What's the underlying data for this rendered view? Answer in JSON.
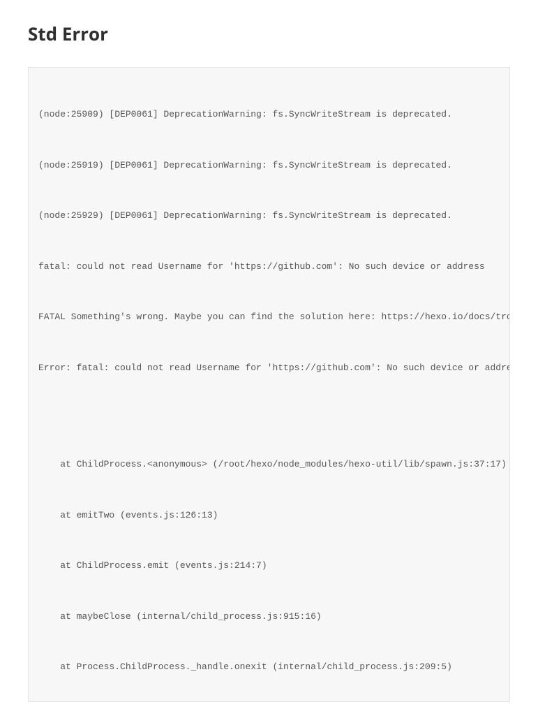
{
  "heading": "Std Error",
  "lines": [
    "(node:25909) [DEP0061] DeprecationWarning: fs.SyncWriteStream is deprecated.",
    "(node:25919) [DEP0061] DeprecationWarning: fs.SyncWriteStream is deprecated.",
    "(node:25929) [DEP0061] DeprecationWarning: fs.SyncWriteStream is deprecated.",
    "fatal: could not read Username for 'https://github.com': No such device or address",
    "FATAL Something's wrong. Maybe you can find the solution here: https://hexo.io/docs/troubleshooting.html",
    "Error: fatal: could not read Username for 'https://github.com': No such device or address",
    "",
    "    at ChildProcess.<anonymous> (/root/hexo/node_modules/hexo-util/lib/spawn.js:37:17)",
    "    at emitTwo (events.js:126:13)",
    "    at ChildProcess.emit (events.js:214:7)",
    "    at maybeClose (internal/child_process.js:915:16)",
    "    at Process.ChildProcess._handle.onexit (internal/child_process.js:209:5)"
  ]
}
